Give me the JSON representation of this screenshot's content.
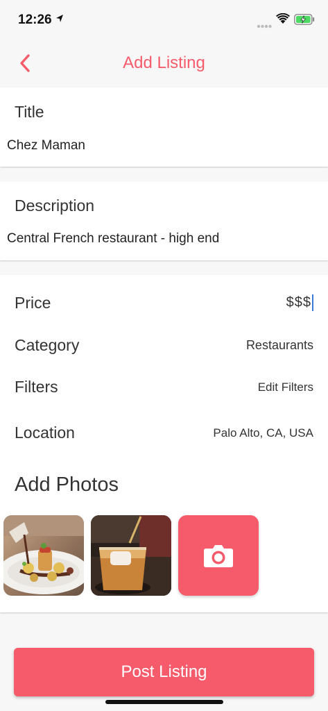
{
  "status_bar": {
    "time": "12:26",
    "icons": [
      "location-arrow-icon",
      "signal-dots-icon",
      "wifi-icon",
      "battery-charging-icon"
    ]
  },
  "nav": {
    "back_icon": "chevron-left-icon",
    "title": "Add Listing"
  },
  "title_field": {
    "label": "Title",
    "value": "Chez Maman"
  },
  "description_field": {
    "label": "Description",
    "value": "Central French restaurant - high end"
  },
  "details": {
    "price": {
      "label": "Price",
      "value": "$$$"
    },
    "category": {
      "label": "Category",
      "value": "Restaurants"
    },
    "filters": {
      "label": "Filters",
      "value": "Edit Filters"
    },
    "location": {
      "label": "Location",
      "value": "Palo Alto, CA, USA"
    }
  },
  "photos": {
    "title": "Add Photos",
    "add_icon": "camera-icon"
  },
  "post_button": {
    "label": "Post Listing"
  },
  "colors": {
    "accent": "#f55b6b",
    "background": "#f7f7f7",
    "card": "#ffffff",
    "cursor": "#3a7bd5"
  }
}
